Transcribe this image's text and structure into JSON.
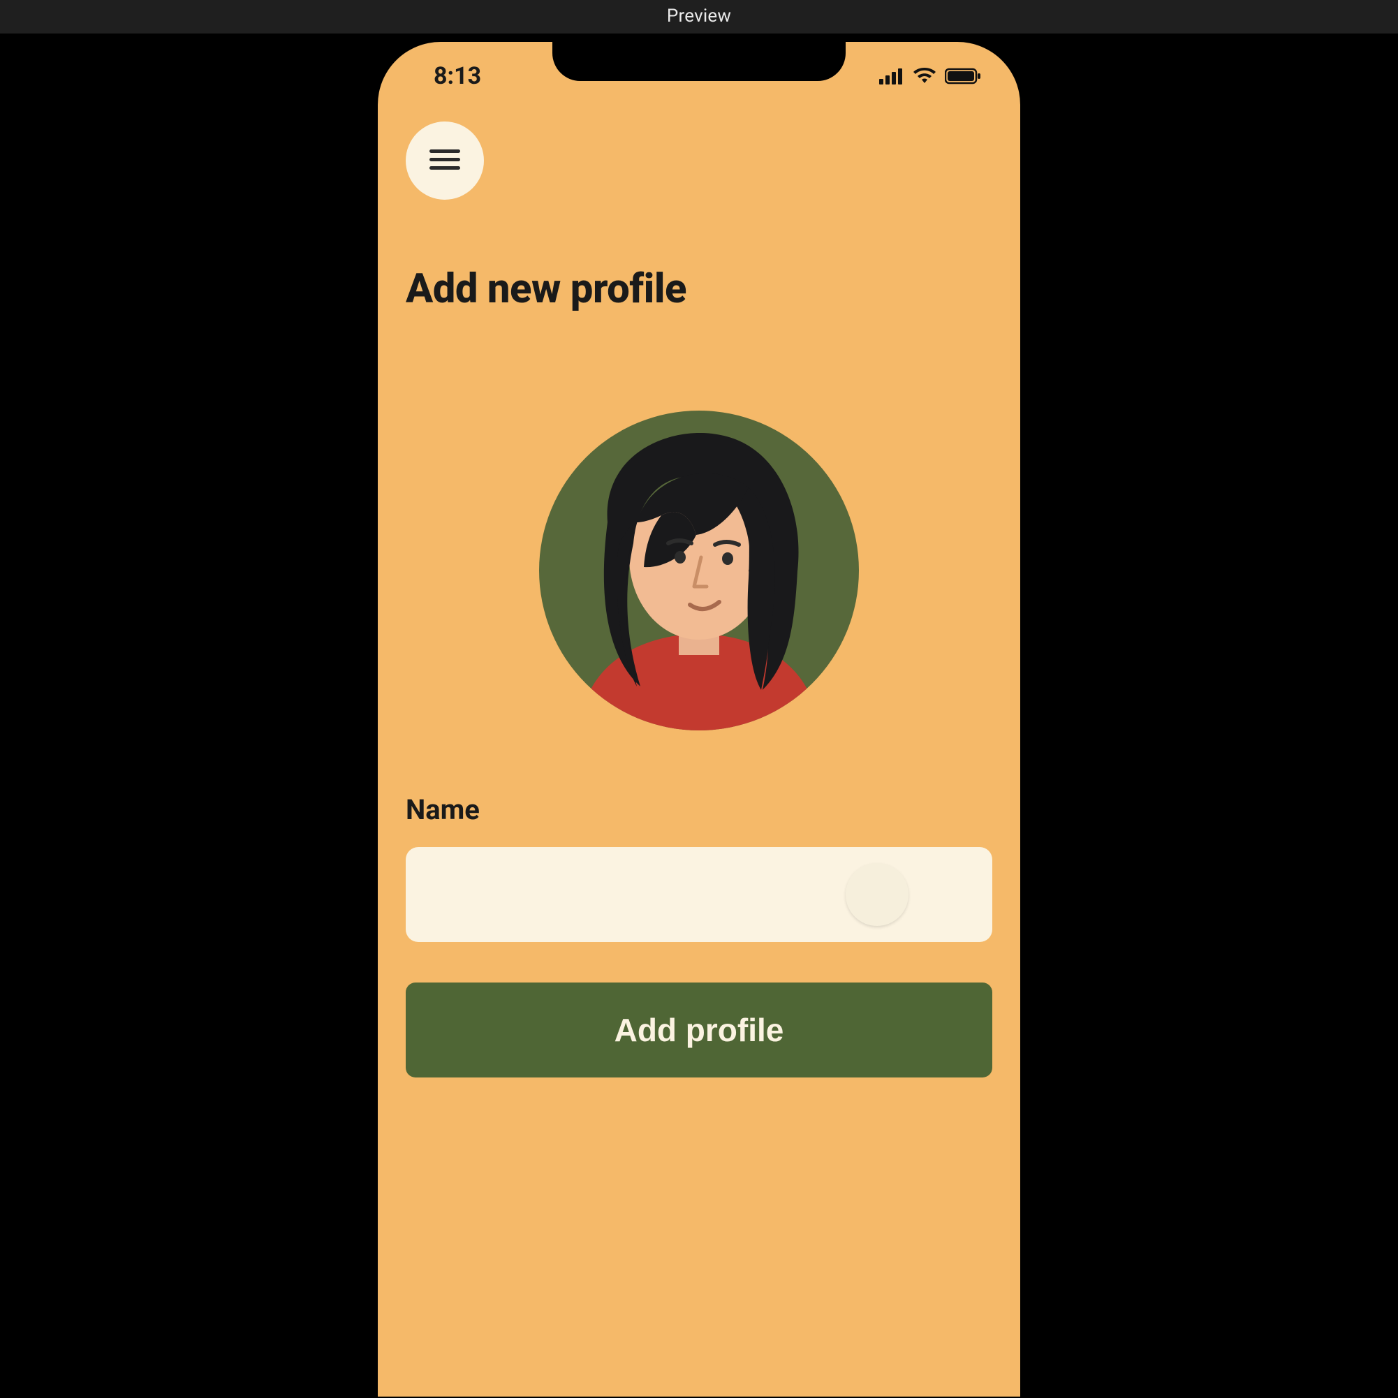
{
  "previewBar": {
    "label": "Preview"
  },
  "statusBar": {
    "time": "8:13"
  },
  "page": {
    "title": "Add new profile",
    "nameLabel": "Name",
    "nameValue": "",
    "namePlaceholder": "",
    "submitLabel": "Add profile"
  },
  "colors": {
    "phoneBg": "#f5b969",
    "cream": "#fbf3e1",
    "olive": "#4f6635",
    "avatarBg": "#57683a"
  }
}
